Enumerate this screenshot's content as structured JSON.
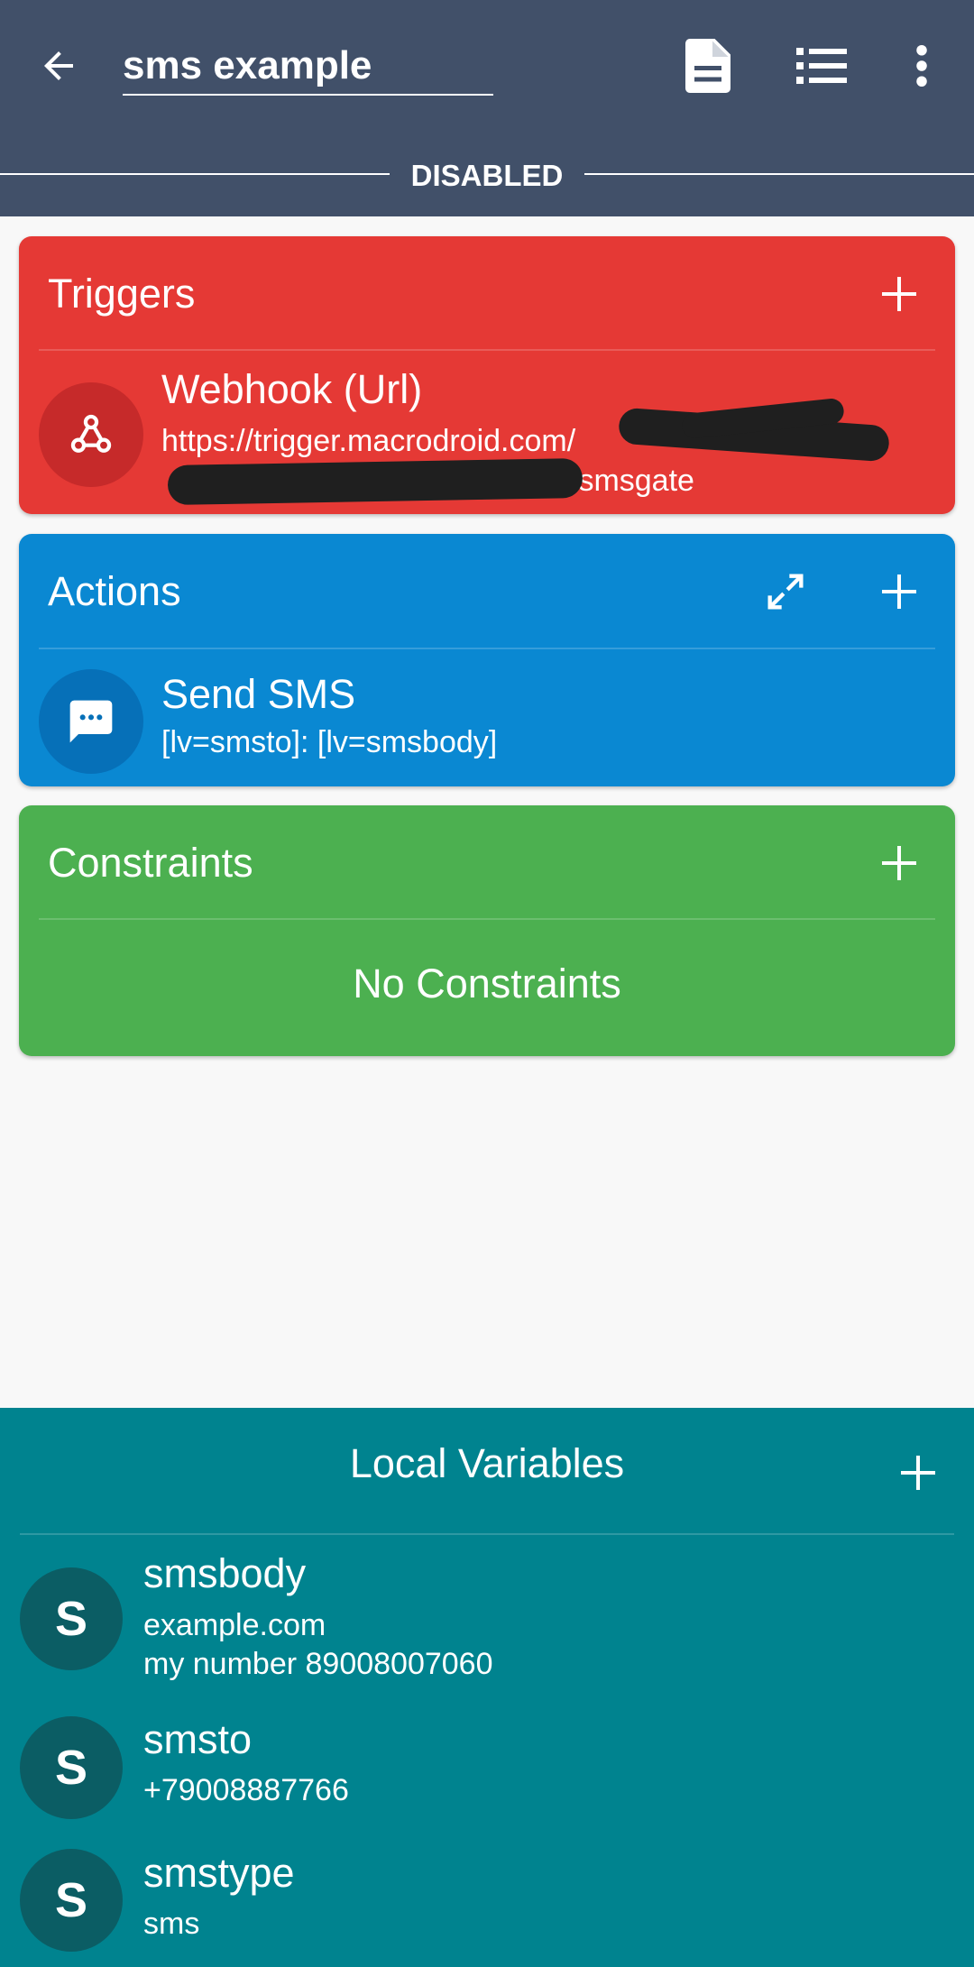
{
  "header": {
    "title": "sms example",
    "status": "DISABLED",
    "icons": [
      "back-arrow-icon",
      "document-icon",
      "list-icon",
      "more-vert-icon"
    ]
  },
  "triggers": {
    "title": "Triggers",
    "add_label": "+",
    "items": [
      {
        "icon": "webhook-icon",
        "title": "Webhook (Url)",
        "line1": "https://trigger.macrodroid.com/",
        "line2": "/smsgate"
      }
    ]
  },
  "actions": {
    "title": "Actions",
    "add_label": "+",
    "items": [
      {
        "icon": "message-icon",
        "title": "Send SMS",
        "subtitle": "[lv=smsto]: [lv=smsbody]"
      }
    ]
  },
  "constraints": {
    "title": "Constraints",
    "add_label": "+",
    "empty_text": "No Constraints"
  },
  "local_variables": {
    "title": "Local Variables",
    "add_label": "+",
    "items": [
      {
        "avatar": "S",
        "name": "smsbody",
        "value_lines": [
          "example.com",
          "my number 89008007060"
        ]
      },
      {
        "avatar": "S",
        "name": "smsto",
        "value_lines": [
          "+79008887766"
        ]
      },
      {
        "avatar": "S",
        "name": "smstype",
        "value_lines": [
          "sms"
        ]
      }
    ]
  },
  "colors": {
    "appbar": "#415069",
    "triggers": "#e53935",
    "actions": "#0a88d2",
    "constraints": "#4cb050",
    "locals": "#00838f"
  }
}
